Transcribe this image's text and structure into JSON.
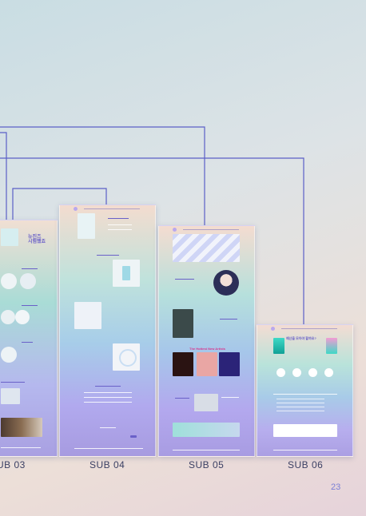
{
  "labels": {
    "sub03": "UB 03",
    "sub04": "SUB 04",
    "sub05": "SUB 05",
    "sub06": "SUB 06"
  },
  "page_number": "23",
  "sub03": {
    "hero_title": "뉴진즈\n시험했죠"
  },
  "sub05": {
    "hottest_title": "The Hottest New Artists"
  },
  "sub06": {
    "hero_title": "예산을 모아야 할까요?"
  },
  "colors": {
    "connector": "#5b5fc7",
    "label": "#3a3f63",
    "page_number": "#7b7fd6"
  }
}
